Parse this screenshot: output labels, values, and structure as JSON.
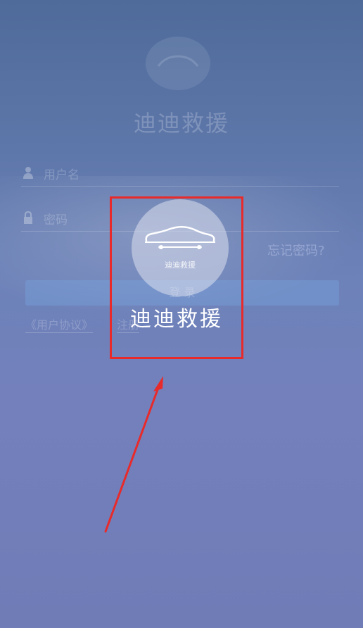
{
  "background_screen": {
    "title": "迪迪救援",
    "username_placeholder": "用户名",
    "password_placeholder": "密码",
    "forgot_password": "忘记密码?",
    "login_button": "登 录",
    "user_agreement": "《用户协议》",
    "register": "注册"
  },
  "splash": {
    "logo_caption": "迪迪救援",
    "title": "迪迪救援"
  },
  "icons": {
    "logo": "car-wrench-icon",
    "user": "user-icon",
    "lock": "lock-icon"
  },
  "colors": {
    "highlight": "#e82a2a",
    "arrow": "#e82a2a"
  }
}
